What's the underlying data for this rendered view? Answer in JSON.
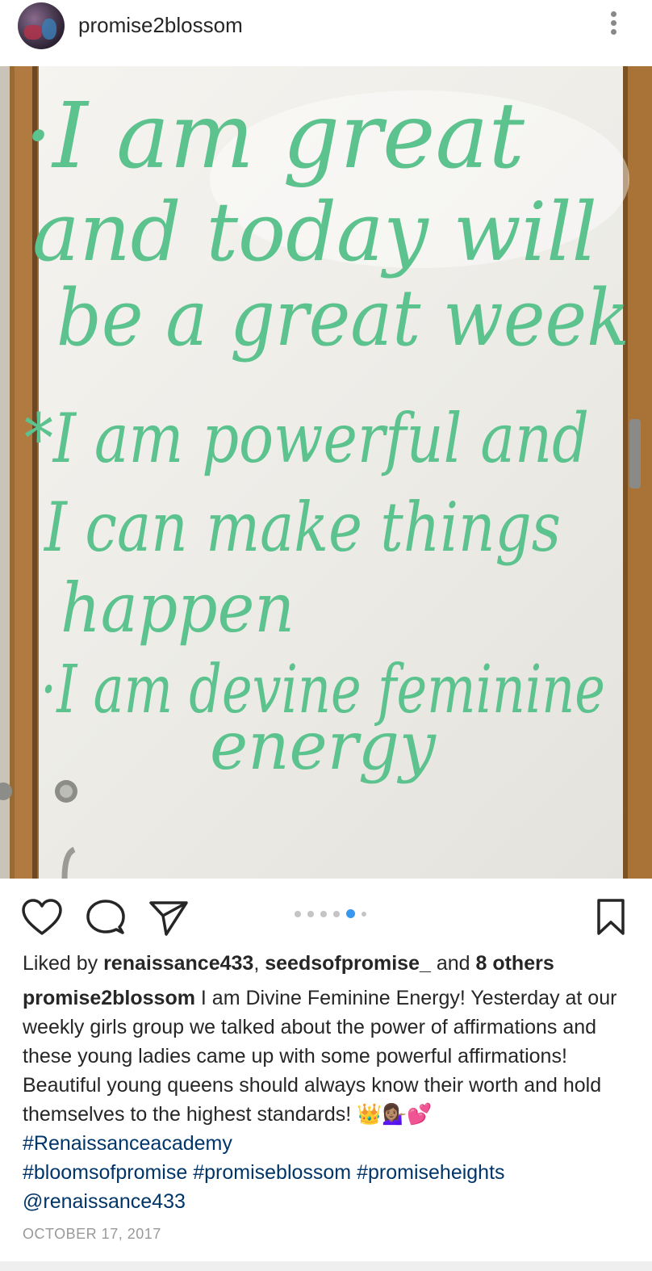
{
  "post": {
    "username": "promise2blossom",
    "avatar_label": "profile photo",
    "more_icon": "more-vertical-icon"
  },
  "photo": {
    "board_lines": [
      "·I am great",
      "and today will",
      "be a great week",
      "*I am powerful and",
      "I can make things",
      "happen",
      "·I am devine feminine",
      "energy"
    ],
    "ink_color": "#5cc28e"
  },
  "actions": {
    "like_icon": "heart-icon",
    "comment_icon": "comment-icon",
    "share_icon": "send-icon",
    "save_icon": "bookmark-icon",
    "carousel_total": 6,
    "carousel_active": 5
  },
  "likes": {
    "prefix": "Liked by ",
    "user1": "renaissance433",
    "sep": ", ",
    "user2": "seedsofpromise_",
    "and": " and ",
    "others": "8 others"
  },
  "caption": {
    "username": "promise2blossom",
    "text": " I am Divine Feminine Energy! Yesterday at our weekly girls group we talked about the power of affirmations and these young ladies came up with some powerful affirmations! Beautiful young queens should always know their worth and hold themselves to the highest standards! 👑💁🏽‍♀️💕 ",
    "tag1": "#Renaissanceacademy",
    "tag2": "#bloomsofpromise",
    "tag3": "#promiseblossom",
    "tag4": "#promiseheights",
    "mention": "@renaissance433"
  },
  "date": "OCTOBER 17, 2017",
  "colors": {
    "link": "#003569",
    "accent": "#3897f0",
    "text": "#262626",
    "muted": "#999999"
  }
}
